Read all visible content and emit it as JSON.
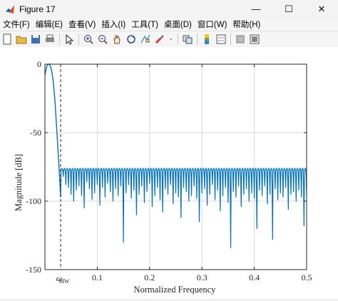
{
  "window": {
    "title": "Figure 17"
  },
  "window_controls": {
    "minimize": "—",
    "maximize": "☐",
    "close": "✕"
  },
  "menu": [
    "文件(F)",
    "编辑(E)",
    "查看(V)",
    "插入(I)",
    "工具(T)",
    "桌面(D)",
    "窗口(W)",
    "帮助(H)"
  ],
  "toolbar": {
    "icons": [
      "new-figure-icon",
      "open-file-icon",
      "save-icon",
      "print-icon",
      "|",
      "pointer-icon",
      "|",
      "zoom-in-icon",
      "zoom-out-icon",
      "pan-hand-icon",
      "rotate-3d-icon",
      "data-cursor-icon",
      "brush-icon",
      "dropdown-arrow-icon",
      "|",
      "link-plot-icon",
      "|",
      "colorbar-icon",
      "legend-icon",
      "|",
      "hide-plot-tools-icon",
      "show-plot-tools-icon"
    ]
  },
  "colors": {
    "line": "#0072bd",
    "axes": "#262626",
    "grid": "#d9d9d9"
  },
  "chart_data": {
    "type": "line",
    "xlabel": "Normalized Frequency",
    "ylabel": "Magnitude [dB]",
    "xlim": [
      0,
      0.5
    ],
    "ylim": [
      -150,
      0
    ],
    "xticks": [
      0.1,
      0.2,
      0.3,
      0.4,
      0.5
    ],
    "xtick_labels": [
      "0.1",
      "0.2",
      "0.3",
      "0.4",
      "0.5"
    ],
    "yticks": [
      0,
      -50,
      -100,
      -150
    ],
    "ytick_labels": [
      "0",
      "-50",
      "-100",
      "-150"
    ],
    "grid": true,
    "marker": {
      "x": 0.03,
      "label": "ω",
      "subscript": "MW",
      "style": "dashed"
    },
    "mainlobe": {
      "x": [
        0.0,
        0.002,
        0.004,
        0.006,
        0.008,
        0.01,
        0.013,
        0.016,
        0.019,
        0.022,
        0.025,
        0.028,
        0.03
      ],
      "y": [
        -8,
        -4,
        -1,
        0,
        0,
        -1,
        -5,
        -13,
        -26,
        -44,
        -63,
        -82,
        -97
      ]
    },
    "sidelobes": {
      "x_start": 0.03,
      "x_end": 0.5,
      "lobe_count": 94,
      "peak_level_db": -76,
      "null_depths_db": [
        -82,
        -88,
        -90,
        -95,
        -100,
        -92,
        -89,
        -96,
        -105,
        -86,
        -91,
        -99,
        -94,
        -88,
        -103,
        -90,
        -97,
        -87,
        -93,
        -100,
        -91,
        -96,
        -89,
        -130,
        -94,
        -88,
        -98,
        -92,
        -110,
        -95,
        -89,
        -101,
        -93,
        -87,
        -104,
        -96,
        -90,
        -99,
        -108,
        -91,
        -95,
        -88,
        -102,
        -94,
        -97,
        -112,
        -90,
        -93,
        -100,
        -96,
        -89,
        -98,
        -115,
        -94,
        -91,
        -103,
        -95,
        -88,
        -99,
        -92,
        -107,
        -96,
        -90,
        -101,
        -134,
        -93,
        -97,
        -89,
        -104,
        -95,
        -91,
        -100,
        -94,
        -98,
        -120,
        -92,
        -96,
        -89,
        -102,
        -95,
        -128,
        -91,
        -99,
        -94,
        -97,
        -90,
        -106,
        -95,
        -93,
        -100,
        -92,
        -97,
        -118,
        -96
      ]
    }
  }
}
